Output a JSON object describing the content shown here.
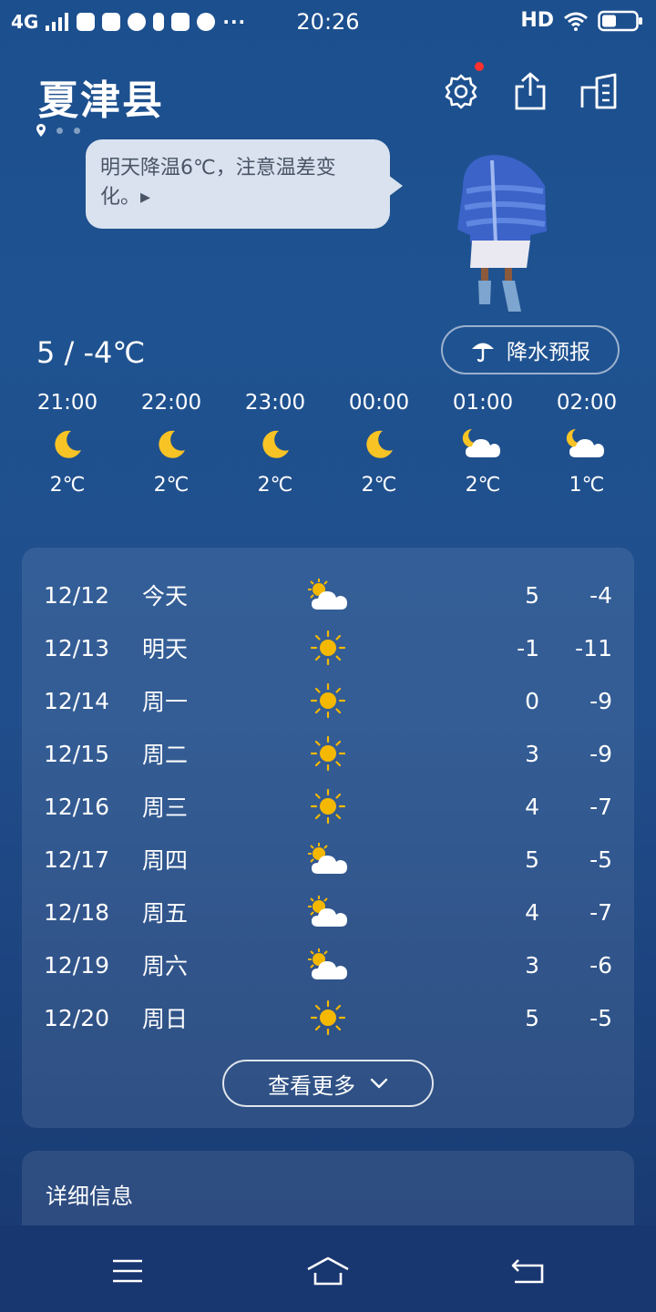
{
  "status_bar": {
    "network": "4G",
    "time": "20:26",
    "hd": "HD",
    "more_dots": "···"
  },
  "header": {
    "city": "夏津县"
  },
  "tip": {
    "text": "明天降温6℃，注意温差变化。▸"
  },
  "today": {
    "temp_range": "5 / -4℃",
    "rain_forecast_label": "降水预报"
  },
  "hourly": [
    {
      "time": "21:00",
      "icon": "moon-icon",
      "temp": "2℃"
    },
    {
      "time": "22:00",
      "icon": "moon-icon",
      "temp": "2℃"
    },
    {
      "time": "23:00",
      "icon": "moon-icon",
      "temp": "2℃"
    },
    {
      "time": "00:00",
      "icon": "moon-icon",
      "temp": "2℃"
    },
    {
      "time": "01:00",
      "icon": "moon-cloud-icon",
      "temp": "2℃"
    },
    {
      "time": "02:00",
      "icon": "moon-cloud-icon",
      "temp": "1℃"
    }
  ],
  "daily": [
    {
      "date": "12/12",
      "day": "今天",
      "icon": "sun-cloud-icon",
      "high": "5",
      "low": "-4"
    },
    {
      "date": "12/13",
      "day": "明天",
      "icon": "sun-icon",
      "high": "-1",
      "low": "-11"
    },
    {
      "date": "12/14",
      "day": "周一",
      "icon": "sun-icon",
      "high": "0",
      "low": "-9"
    },
    {
      "date": "12/15",
      "day": "周二",
      "icon": "sun-icon",
      "high": "3",
      "low": "-9"
    },
    {
      "date": "12/16",
      "day": "周三",
      "icon": "sun-icon",
      "high": "4",
      "low": "-7"
    },
    {
      "date": "12/17",
      "day": "周四",
      "icon": "sun-cloud-icon",
      "high": "5",
      "low": "-5"
    },
    {
      "date": "12/18",
      "day": "周五",
      "icon": "sun-cloud-icon",
      "high": "4",
      "low": "-7"
    },
    {
      "date": "12/19",
      "day": "周六",
      "icon": "sun-cloud-icon",
      "high": "3",
      "low": "-6"
    },
    {
      "date": "12/20",
      "day": "周日",
      "icon": "sun-icon",
      "high": "5",
      "low": "-5"
    }
  ],
  "more_label": "查看更多",
  "details": {
    "title": "详细信息"
  },
  "colors": {
    "background_top": "#1c4f8e",
    "background_bottom": "#183770",
    "sun": "#f5b800",
    "moon": "#f7c325",
    "badge": "#ff3030",
    "bubble": "#d9e2ee"
  }
}
